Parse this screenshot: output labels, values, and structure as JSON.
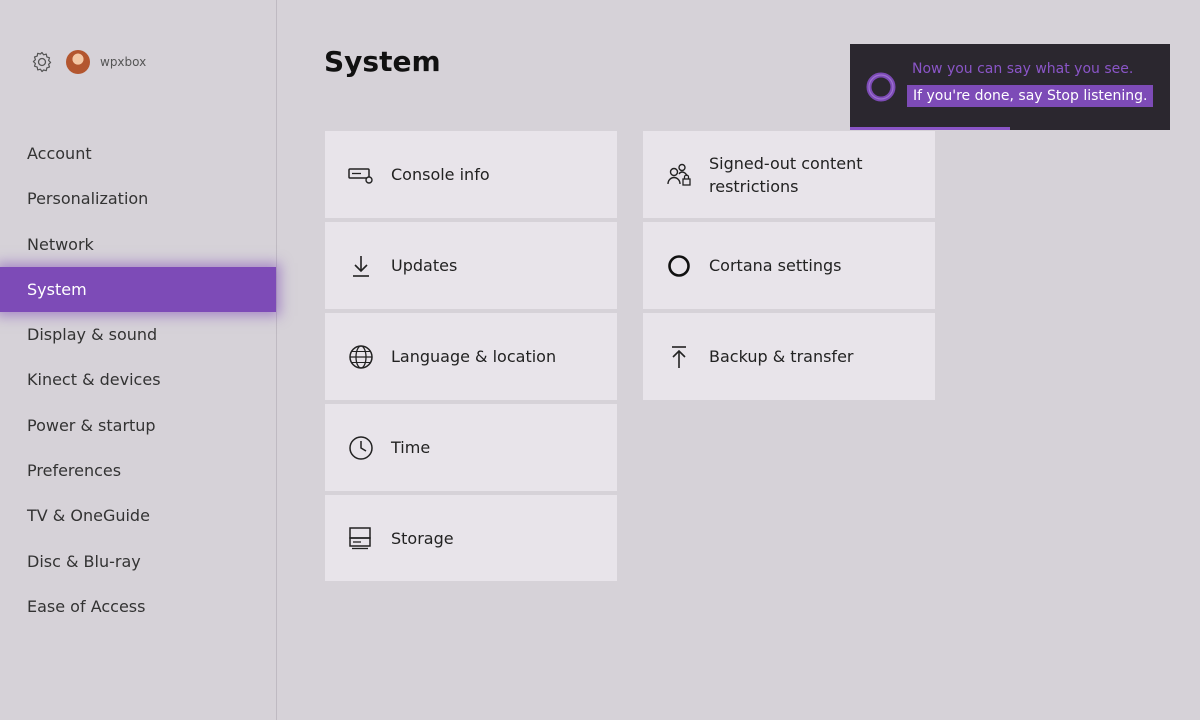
{
  "header": {
    "username": "wpxbox",
    "title": "System"
  },
  "sidebar": {
    "items": [
      {
        "label": "Account",
        "active": false
      },
      {
        "label": "Personalization",
        "active": false
      },
      {
        "label": "Network",
        "active": false
      },
      {
        "label": "System",
        "active": true
      },
      {
        "label": "Display & sound",
        "active": false
      },
      {
        "label": "Kinect & devices",
        "active": false
      },
      {
        "label": "Power & startup",
        "active": false
      },
      {
        "label": "Preferences",
        "active": false
      },
      {
        "label": "TV & OneGuide",
        "active": false
      },
      {
        "label": "Disc & Blu-ray",
        "active": false
      },
      {
        "label": "Ease of Access",
        "active": false
      }
    ]
  },
  "tiles": {
    "console_info": {
      "label": "Console info",
      "icon": "console-icon"
    },
    "updates": {
      "label": "Updates",
      "icon": "download-icon"
    },
    "language_location": {
      "label": "Language & location",
      "icon": "globe-icon"
    },
    "time": {
      "label": "Time",
      "icon": "clock-icon"
    },
    "storage": {
      "label": "Storage",
      "icon": "storage-icon"
    },
    "signed_out": {
      "label": "Signed-out content\nrestrictions",
      "icon": "people-lock-icon"
    },
    "cortana": {
      "label": "Cortana settings",
      "icon": "cortana-ring-icon"
    },
    "backup": {
      "label": "Backup & transfer",
      "icon": "upload-icon"
    }
  },
  "toast": {
    "line1": "Now you can say what you see.",
    "line2": "If you're done, say Stop listening.",
    "progress": 0.5
  },
  "colors": {
    "accent": "#7d4bb7",
    "toast_bg": "#2b272f",
    "tile_bg": "#e8e4ea",
    "background": "#d6d2d8"
  }
}
